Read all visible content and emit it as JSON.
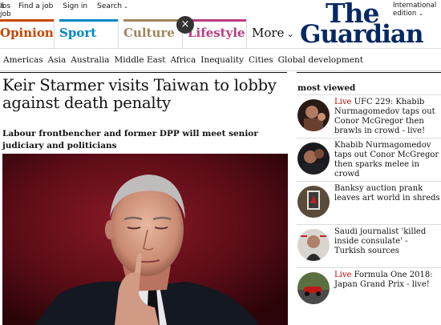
{
  "topbar": {
    "jobs": "Find a job",
    "signin": "Sign in",
    "search": "Search",
    "edition_line1": "International",
    "edition_line2": "edition"
  },
  "logo": {
    "line1": "The",
    "line2": "Guardian"
  },
  "pillars": {
    "opinion": "Opinion",
    "sport": "Sport",
    "culture": "Culture",
    "lifestyle": "Lifestyle",
    "more": "More"
  },
  "close_label": "×",
  "subnav": [
    "Americas",
    "Asia",
    "Australia",
    "Middle East",
    "Africa",
    "Inequality",
    "Cities",
    "Global development"
  ],
  "article": {
    "headline": "Keir Starmer visits Taiwan to lobby against death penalty",
    "standfirst": "Labour frontbencher and former DPP will meet senior judiciary and politicians"
  },
  "most_viewed": {
    "title": "most viewed",
    "items": [
      {
        "live": "Live",
        "text": "UFC 229: Khabib Nurmagomedov taps out Conor McGregor then brawls in crowd - live!"
      },
      {
        "live": "",
        "text": "Khabib Nurmagomedov taps out Conor McGregor then sparks melee in crowd"
      },
      {
        "live": "",
        "text": "Banksy auction prank leaves art world in shreds"
      },
      {
        "live": "",
        "text": "Saudi journalist 'killed inside consulate' - Turkish sources"
      },
      {
        "live": "Live",
        "text": "Formula One 2018: Japan Grand Prix - live!"
      }
    ]
  },
  "colors": {
    "opinion": "#c74600",
    "sport": "#0084c6",
    "culture": "#a1845c",
    "lifestyle": "#bb3b80",
    "brand": "#052962",
    "live": "#c70000"
  }
}
